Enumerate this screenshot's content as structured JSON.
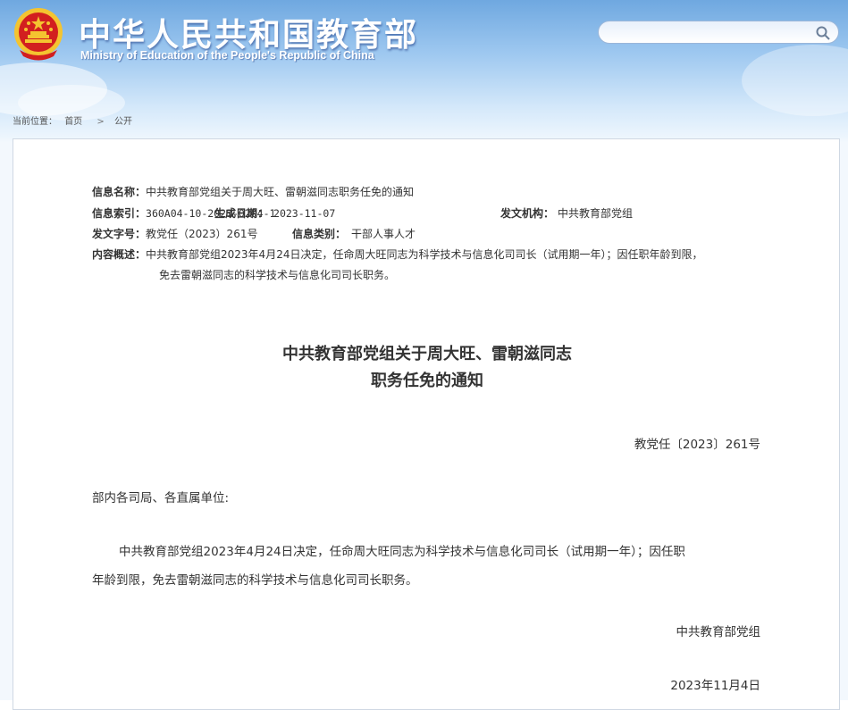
{
  "header": {
    "title_cn": "中华人民共和国教育部",
    "title_en": "Ministry of Education of the People's Republic of China"
  },
  "search": {
    "placeholder": ""
  },
  "breadcrumb": {
    "label": "当前位置：",
    "items": [
      "首页",
      "公开"
    ]
  },
  "meta": {
    "name_label": "信息名称：",
    "name_value": "中共教育部党组关于周大旺、雷朝滋同志职务任免的通知",
    "index_label": "信息索引：",
    "index_value": "360A04-10-2023-0204-1",
    "date_label": "生成日期：",
    "date_value": "2023-11-07",
    "org_label": "发文机构：",
    "org_value": "中共教育部党组",
    "docno_label": "发文字号：",
    "docno_value": "教党任（2023）261号",
    "category_label": "信息类别：",
    "category_value": "干部人事人才",
    "summary_label": "内容概述：",
    "summary_line1": "中共教育部党组2023年4月24日决定，任命周大旺同志为科学技术与信息化司司长（试用期一年）；因任职年龄到限，",
    "summary_line2": "免去雷朝滋同志的科学技术与信息化司司长职务。"
  },
  "document": {
    "title_line1": "中共教育部党组关于周大旺、雷朝滋同志",
    "title_line2": "职务任免的通知",
    "doc_number": "教党任〔2023〕261号",
    "addressee": "部内各司局、各直属单位:",
    "body_line1": "中共教育部党组2023年4月24日决定，任命周大旺同志为科学技术与信息化司司长（试用期一年）；因任职",
    "body_line2": "年龄到限，免去雷朝滋同志的科学技术与信息化司司长职务。",
    "signature": "中共教育部党组",
    "date": "2023年11月4日"
  },
  "colors": {
    "header_top": "#6fa8e0",
    "header_light": "#eaf4fd",
    "text": "#333333",
    "emblem_red": "#d21f1f",
    "emblem_gold": "#f4c430"
  }
}
